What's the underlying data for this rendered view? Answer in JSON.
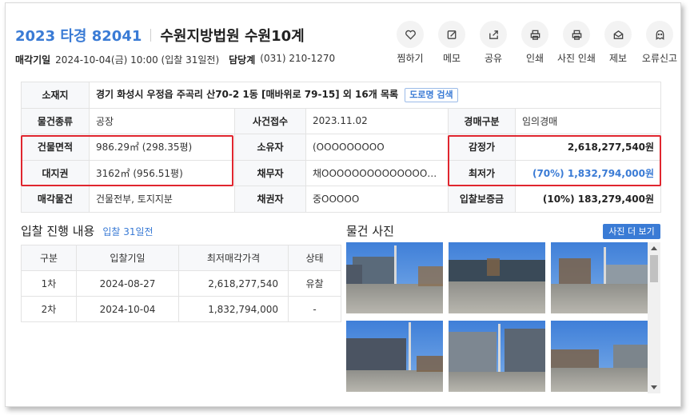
{
  "header": {
    "case_no": "2023 타경 82041",
    "court": "수원지방법원 수원10계",
    "sale_date_label": "매각기일",
    "sale_date_value": "2024-10-04(금) 10:00 (입찰 31일전)",
    "manager_label": "담당계",
    "manager_value": "(031) 210-1270"
  },
  "actions": [
    {
      "label": "찜하기",
      "icon": "heart-icon"
    },
    {
      "label": "메모",
      "icon": "edit-icon"
    },
    {
      "label": "공유",
      "icon": "share-icon"
    },
    {
      "label": "인쇄",
      "icon": "print-icon"
    },
    {
      "label": "사진 인쇄",
      "icon": "print-icon"
    },
    {
      "label": "제보",
      "icon": "mail-icon"
    },
    {
      "label": "오류신고",
      "icon": "ghost-icon"
    }
  ],
  "detail": {
    "location_label": "소재지",
    "location_value": "경기 화성시 우정읍 주곡리 산70-2 1동 [매바위로 79-15] 외 16개 목록",
    "road_search": "도로명 검색",
    "type_label": "물건종류",
    "type_value": "공장",
    "received_label": "사건접수",
    "received_value": "2023.11.02",
    "auction_type_label": "경매구분",
    "auction_type_value": "임의경매",
    "bldg_area_label": "건물면적",
    "bldg_area_value": "986.29㎡ (298.35평)",
    "owner_label": "소유자",
    "owner_value": "(OOOOOOOOO",
    "appraisal_label": "감정가",
    "appraisal_value": "2,618,277,540원",
    "land_right_label": "대지권",
    "land_right_value": "3162㎡ (956.51평)",
    "debtor_label": "채무자",
    "debtor_value": "채OOOOOOOOOOOOOOOO...",
    "min_price_label": "최저가",
    "min_price_value": "(70%) 1,832,794,000원",
    "sale_item_label": "매각물건",
    "sale_item_value": "건물전부, 토지지분",
    "creditor_label": "채권자",
    "creditor_value": "중OOOOO",
    "deposit_label": "입찰보증금",
    "deposit_value": "(10%) 183,279,400원"
  },
  "bids": {
    "title": "입찰 진행 내용",
    "subtitle": "입찰 31일전",
    "headers": [
      "구분",
      "입찰기일",
      "최저매각가격",
      "상태"
    ],
    "rows": [
      [
        "1차",
        "2024-08-27",
        "2,618,277,540",
        "유찰"
      ],
      [
        "2차",
        "2024-10-04",
        "1,832,794,000",
        "-"
      ]
    ]
  },
  "photos": {
    "title": "물건 사진",
    "more_button": "사진 더 보기"
  }
}
